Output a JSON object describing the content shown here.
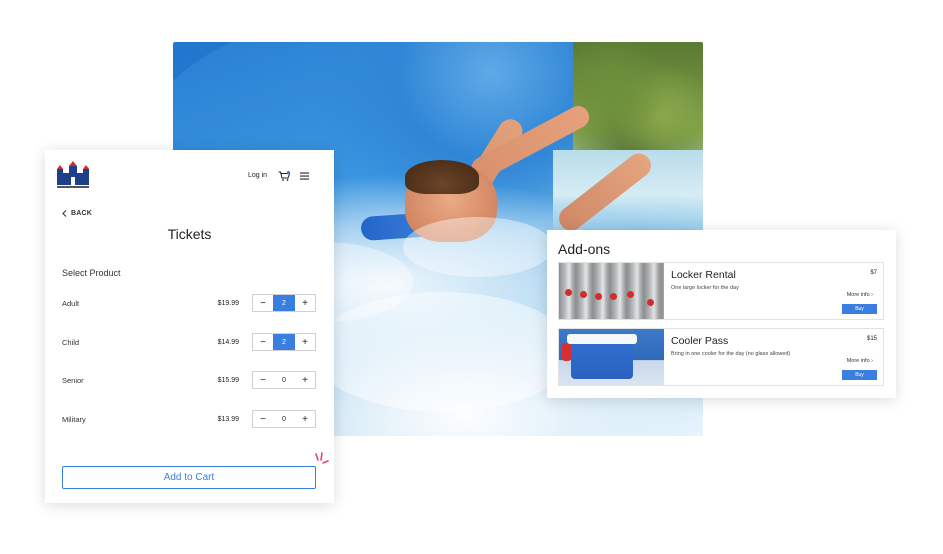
{
  "tickets": {
    "login_label": "Log in",
    "back_label": "BACK",
    "title": "Tickets",
    "subtitle": "Select Product",
    "rows": [
      {
        "name": "Adult",
        "price": "$19.99",
        "qty": "2",
        "active": true
      },
      {
        "name": "Child",
        "price": "$14.99",
        "qty": "2",
        "active": true
      },
      {
        "name": "Senior",
        "price": "$15.99",
        "qty": "0",
        "active": false
      },
      {
        "name": "Military",
        "price": "$13.99",
        "qty": "0",
        "active": false
      }
    ],
    "minus_label": "−",
    "plus_label": "+",
    "add_to_cart_label": "Add to Cart"
  },
  "addons": {
    "heading": "Add-ons",
    "items": [
      {
        "name": "Locker Rental",
        "description": "One large locker for the day",
        "price": "$7",
        "more_label": "More info ›",
        "buy_label": "Buy",
        "thumb": "locker-photo"
      },
      {
        "name": "Cooler Pass",
        "description": "Bring in one cooler for the day (no glass allowed)",
        "price": "$15",
        "more_label": "More info ›",
        "buy_label": "Buy",
        "thumb": "cooler-photo"
      }
    ]
  },
  "icons": {
    "logo": "castle-logo",
    "cart": "cart-icon",
    "menu": "hamburger-menu-icon",
    "back": "chevron-left-icon",
    "sparkle": "sparkle-icon"
  },
  "colors": {
    "accent": "#3a7fe0",
    "text": "#222222",
    "border": "#d0d0d0"
  }
}
